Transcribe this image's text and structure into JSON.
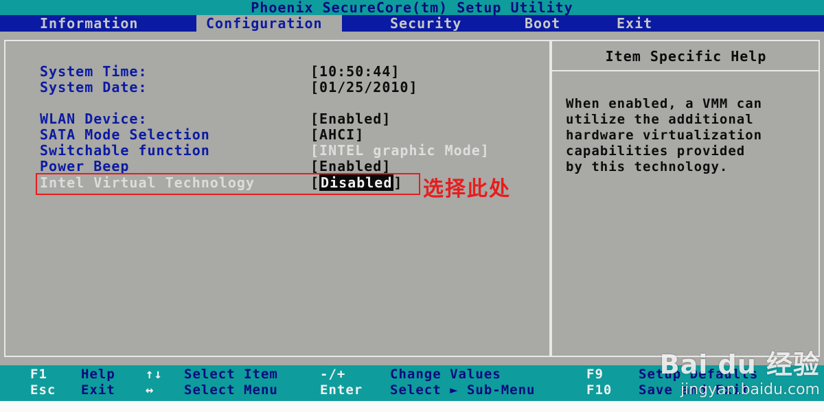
{
  "title": "Phoenix SecureCore(tm) Setup Utility",
  "menu": {
    "items": [
      "Information",
      "Configuration",
      "Security",
      "Boot",
      "Exit"
    ],
    "active_index": 1
  },
  "settings": [
    {
      "label": "System Time:",
      "value": "[10:50:44]"
    },
    {
      "label": "System Date:",
      "value": "[01/25/2010]"
    },
    {
      "label": "WLAN Device:",
      "value": "[Enabled]"
    },
    {
      "label": "SATA Mode Selection",
      "value": "[AHCI]"
    },
    {
      "label": "Switchable function",
      "value": "[INTEL graphic Mode]"
    },
    {
      "label": "Power Beep",
      "value": "[Enabled]"
    },
    {
      "label": "Intel Virtual Technology",
      "value_open": "[",
      "value": "Disabled",
      "value_close": "]"
    }
  ],
  "annotation": "选择此处",
  "help": {
    "title": "Item Specific Help",
    "lines": [
      "When enabled, a VMM can",
      "utilize the additional",
      "hardware virtualization",
      "capabilities provided",
      "by this technology."
    ]
  },
  "footer": {
    "row1": [
      {
        "key": "F1",
        "desc": "Help"
      },
      {
        "key": "↑↓",
        "desc": "Select Item"
      },
      {
        "key": "-/+",
        "desc": "Change Values"
      },
      {
        "key": "F9",
        "desc": "Setup Defaults"
      }
    ],
    "row2": [
      {
        "key": "Esc",
        "desc": "Exit"
      },
      {
        "key": "↔",
        "desc": "Select Menu"
      },
      {
        "key": "Enter",
        "desc": "Select ► Sub-Menu"
      },
      {
        "key": "F10",
        "desc": "Save and Exit"
      }
    ]
  },
  "watermark": {
    "logo": "Bai du 经验",
    "url": "jingyan.baidu.com"
  }
}
